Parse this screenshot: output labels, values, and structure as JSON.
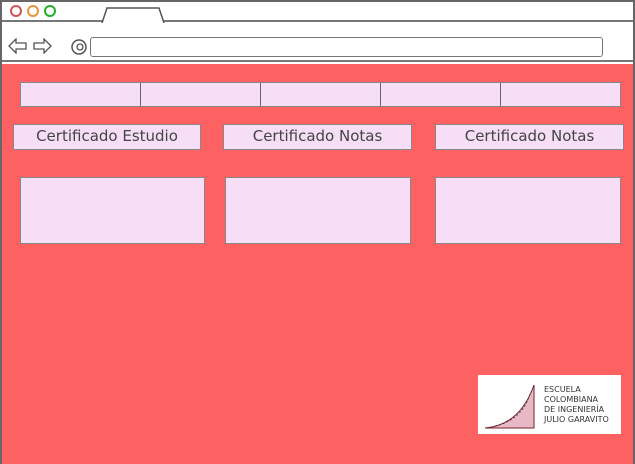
{
  "window": {
    "controls": [
      {
        "name": "close",
        "color": "#d0555a"
      },
      {
        "name": "minimize",
        "color": "#e8953a"
      },
      {
        "name": "maximize",
        "color": "#22b02a"
      }
    ],
    "url": ""
  },
  "content": {
    "background": "#fe6161",
    "menu_items": [
      "",
      "",
      "",
      "",
      ""
    ],
    "buttons": [
      {
        "label": "Certificado Estudio"
      },
      {
        "label": "Certificado Notas"
      },
      {
        "label": "Certificado Notas"
      }
    ],
    "logo": {
      "lines": [
        "Escuela",
        "Colombiana",
        "de Ingeniería",
        "Julio Garavito"
      ]
    }
  }
}
